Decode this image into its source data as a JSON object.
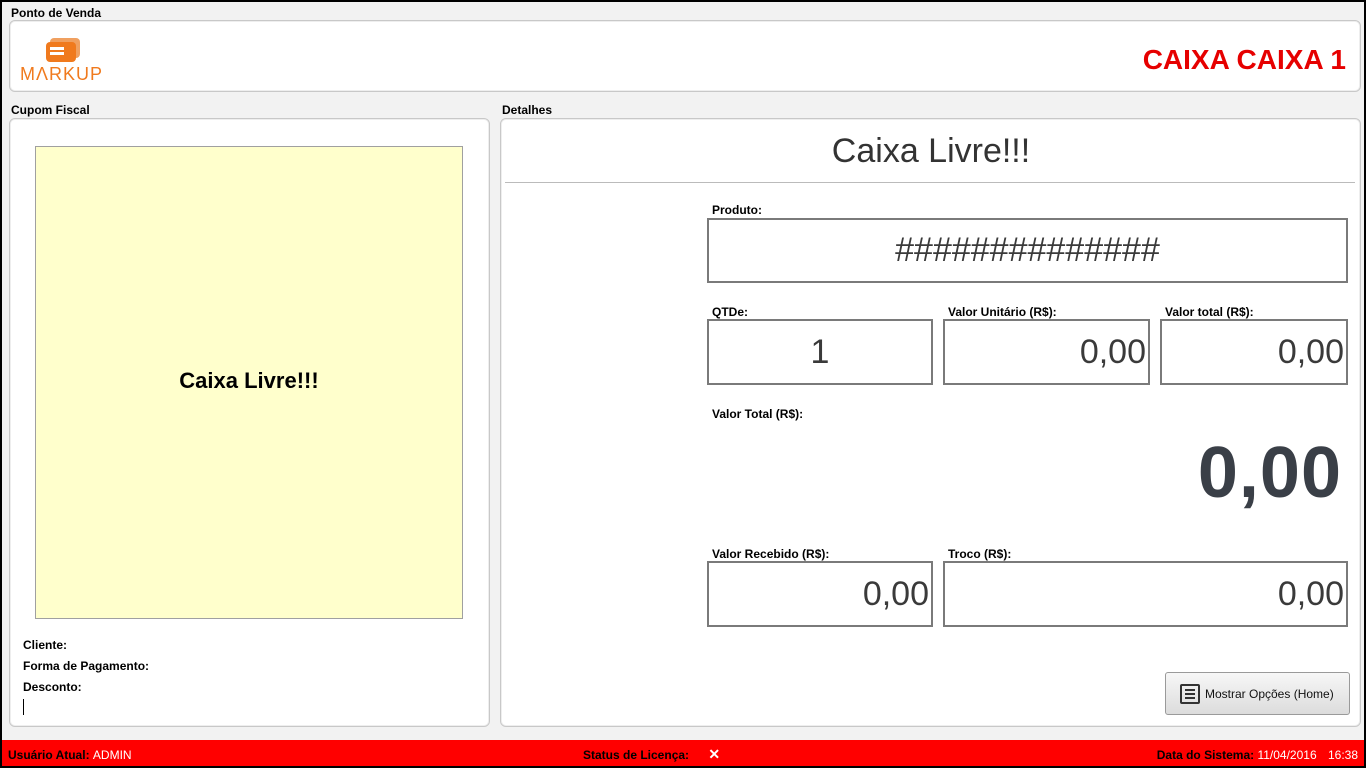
{
  "window": {
    "title": "Ponto de Venda"
  },
  "header": {
    "logo_text": "MARKUP",
    "caixa_title": "CAIXA CAIXA 1"
  },
  "cupom": {
    "group_label": "Cupom Fiscal",
    "receipt_text": "Caixa Livre!!!",
    "cliente_label": "Cliente:",
    "pagamento_label": "Forma de Pagamento:",
    "desconto_label": "Desconto:"
  },
  "detalhes": {
    "group_label": "Detalhes",
    "status_title": "Caixa Livre!!!",
    "produto_label": "Produto:",
    "produto_value": "##############",
    "qtde_label": "QTDe:",
    "qtde_value": "1",
    "valor_unitario_label": "Valor Unitário (R$):",
    "valor_unitario_value": "0,00",
    "valor_total_item_label": "Valor total (R$):",
    "valor_total_item_value": "0,00",
    "valor_total_label": "Valor Total (R$):",
    "valor_total_value": "0,00",
    "valor_recebido_label": "Valor Recebido (R$):",
    "valor_recebido_value": "0,00",
    "troco_label": "Troco (R$):",
    "troco_value": "0,00",
    "options_button_label": "Mostrar Opções (Home)"
  },
  "statusbar": {
    "usuario_label": "Usuário Atual:",
    "usuario_value": "ADMIN",
    "licenca_label": "Status de Licença:",
    "data_label": "Data do Sistema:",
    "data_value": "11/04/2016",
    "hora_value": "16:38"
  },
  "colors": {
    "accent_red": "#e60000",
    "statusbar_bg": "#ff0000",
    "receipt_bg": "#ffffcc",
    "logo_orange": "#f07a1e"
  },
  "icons": {
    "logo": "markup-logo-icon",
    "options": "list-icon",
    "license": "close-icon"
  }
}
